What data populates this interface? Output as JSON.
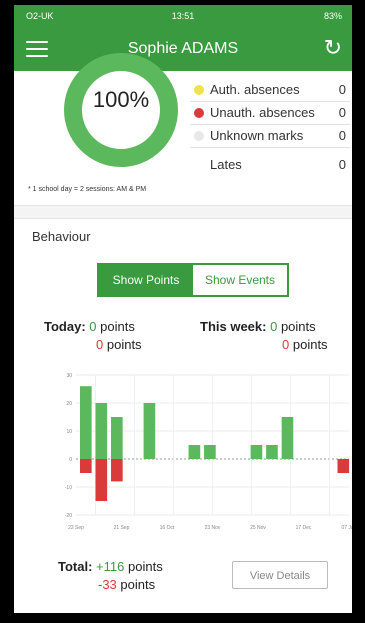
{
  "status_bar": {
    "carrier": "O2-UK",
    "time": "13:51",
    "battery": "83%"
  },
  "header": {
    "title": "Sophie ADAMS",
    "menu_icon": "hamburger-menu-icon",
    "refresh_icon": "refresh-icon"
  },
  "attendance": {
    "percent": "100%",
    "legend": [
      {
        "label": "Auth. absences",
        "value": "0",
        "color": "#f0e34a"
      },
      {
        "label": "Unauth. absences",
        "value": "0",
        "color": "#d93a3a"
      },
      {
        "label": "Unknown marks",
        "value": "0",
        "color": "#e8e8e8"
      }
    ],
    "lates_label": "Lates",
    "lates_value": "0",
    "footnote": "* 1 school day = 2 sessions: AM & PM"
  },
  "behaviour": {
    "section_title": "Behaviour",
    "show_points_label": "Show Points",
    "show_events_label": "Show Events",
    "today_label": "Today:",
    "today_positive": "0",
    "today_negative": "0",
    "points_word": "points",
    "week_label": "This week:",
    "week_positive": "0",
    "week_negative": "0",
    "total_label": "Total:",
    "total_positive": "+116",
    "total_negative": "-33",
    "view_details_label": "View Details"
  },
  "colors": {
    "brand_green": "#3a9a3f",
    "negative_red": "#d93a3a"
  },
  "chart_data": {
    "type": "bar",
    "ylim": [
      -20,
      30
    ],
    "yticks": [
      "30",
      "20",
      "10",
      "0",
      "-10",
      "-20"
    ],
    "xticks": [
      "22 Sep",
      "21 Sep",
      "16 Oct",
      "23 Nov",
      "25 Nov",
      "17 Dec",
      "07 Jan"
    ],
    "series": [
      {
        "values": [
          26,
          20,
          15,
          20,
          5,
          5,
          5,
          5,
          15,
          0
        ]
      },
      {
        "values": [
          -5,
          -15,
          -8,
          0,
          0,
          0,
          0,
          0,
          0,
          -5
        ]
      }
    ]
  }
}
